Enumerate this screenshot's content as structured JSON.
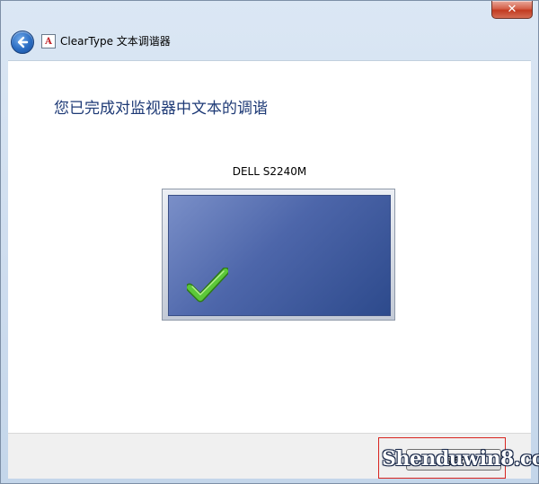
{
  "window": {
    "close_label": "✕"
  },
  "header": {
    "title": "ClearType 文本调谐器"
  },
  "main": {
    "heading": "您已完成对监视器中文本的调谐",
    "monitor_name": "DELL S2240M"
  },
  "footer": {
    "finish_label": "完成"
  },
  "watermark": {
    "text": "Shenduwin8.com"
  },
  "colors": {
    "heading": "#1e3a76",
    "screen": "#4d66aa",
    "check": "#5cc83a",
    "highlight_box": "#d8241f"
  }
}
